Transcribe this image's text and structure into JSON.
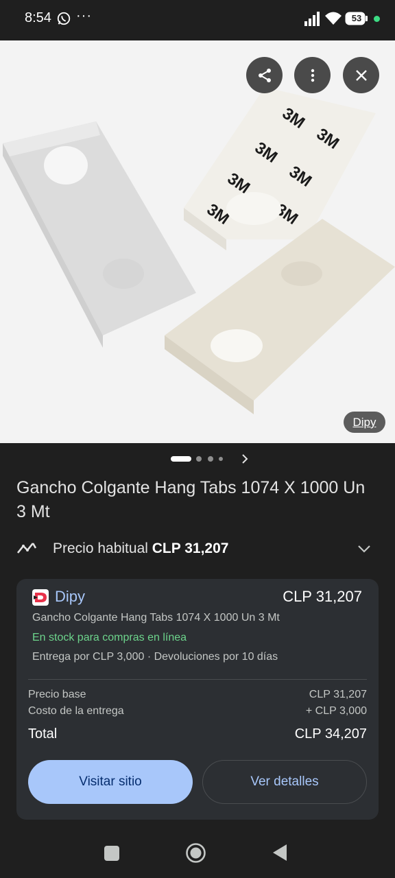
{
  "status_bar": {
    "time": "8:54",
    "battery": "53",
    "more": "···"
  },
  "image_viewer": {
    "source_badge": "Dipy",
    "image_alt": "Product photo of clear adhesive hang tabs with 3M backing",
    "pager": {
      "total": 4,
      "active": 1
    }
  },
  "product": {
    "title": "Gancho Colgante Hang Tabs 1074 X 1000 Un 3 Mt"
  },
  "price_history": {
    "label": "Precio habitual",
    "price": "CLP 31,207"
  },
  "offer": {
    "store_name": "Dipy",
    "price": "CLP 31,207",
    "title": "Gancho Colgante Hang Tabs 1074 X 1000 Un 3 Mt",
    "stock": "En stock para compras en línea",
    "shipping": "Entrega por CLP 3,000 · Devoluciones por 10 días",
    "base_label": "Precio base",
    "base_value": "CLP 31,207",
    "delivery_label": "Costo de la entrega",
    "delivery_value": "+ CLP 3,000",
    "total_label": "Total",
    "total_value": "CLP 34,207",
    "visit_button": "Visitar sitio",
    "details_button": "Ver detalles"
  },
  "colors": {
    "background": "#1f1f1f",
    "card": "#2c2f33",
    "accent": "#a8c7fa",
    "stock_green": "#6dd58c",
    "store_logo_red": "#e8324a"
  }
}
